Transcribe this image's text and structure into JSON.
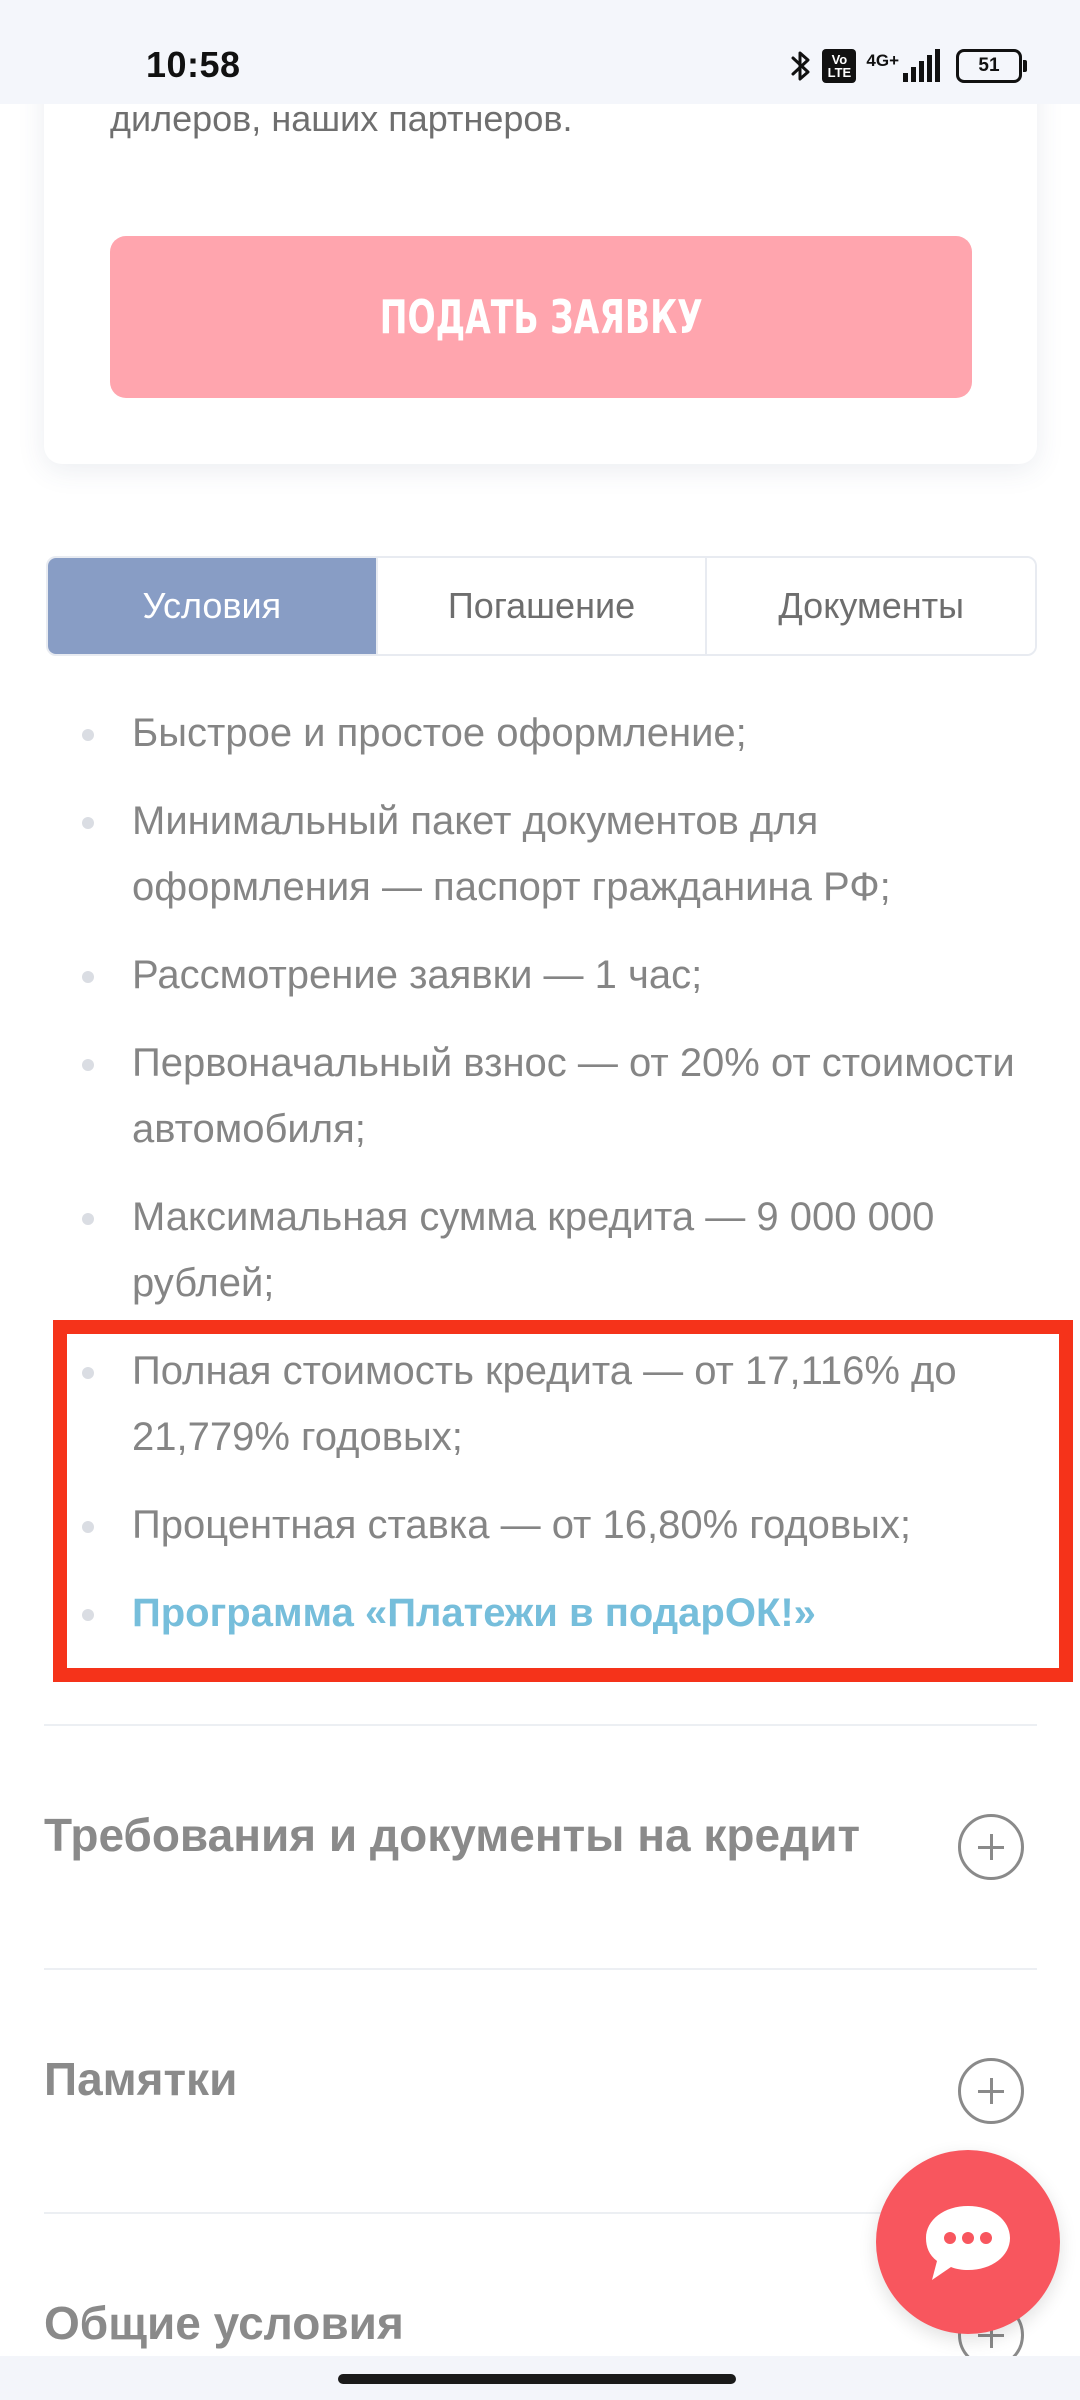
{
  "status_bar": {
    "time": "10:58",
    "volte_label": "Vo LTE",
    "network": "4G+",
    "battery": "51"
  },
  "card": {
    "partial_text": "дилеров, наших партнеров.",
    "apply_label": "ПОДАТЬ ЗАЯВКУ"
  },
  "tabs": [
    {
      "label": "Условия",
      "active": true
    },
    {
      "label": "Погашение",
      "active": false
    },
    {
      "label": "Документы",
      "active": false
    }
  ],
  "conditions": [
    "Быстрое и простое оформление;",
    "Минимальный пакет документов для оформления — паспорт гражданина РФ;",
    "Рассмотрение заявки — 1 час;",
    "Первоначальный взнос — от 20% от стоимости автомобиля;",
    "Максимальная сумма кредита — 9 000 000 рублей;",
    "Полная стоимость кредита — от 17,116% до 21,779% годовых;",
    "Процентная ставка — от 16,80% годовых;"
  ],
  "program_link": "Программа «Платежи в подарОК!»",
  "accordion": [
    {
      "title": "Требования и документы на кредит"
    },
    {
      "title": "Памятки"
    },
    {
      "title": "Общие условия"
    }
  ],
  "colors": {
    "apply_button": "#ffa5ae",
    "active_tab": "#889dc5",
    "link": "#76bedb",
    "highlight": "#f5331a",
    "chat_fab": "#f8565e"
  },
  "icons": {
    "chat": "chat-bubble-icon",
    "plus": "plus-circle-icon",
    "bluetooth": "bluetooth-icon"
  }
}
